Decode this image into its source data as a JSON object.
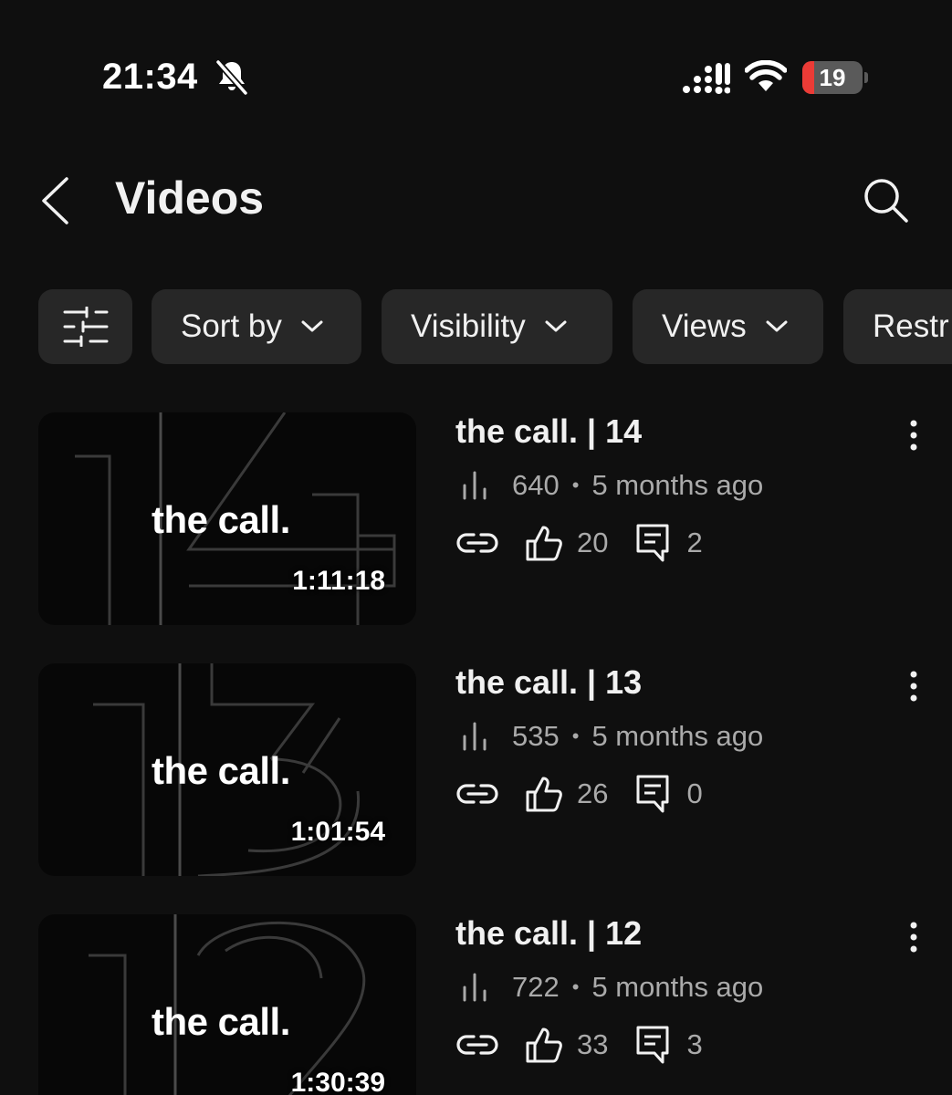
{
  "status_bar": {
    "time": "21:34",
    "battery_level": "19",
    "battery_fraction": 0.19,
    "icons": [
      "bell-off-icon",
      "signal-icon",
      "wifi-icon",
      "battery-icon"
    ]
  },
  "header": {
    "title": "Videos",
    "back_icon": "chevron-left-icon",
    "search_icon": "search-icon"
  },
  "filters": {
    "filter_icon": "sliders-icon",
    "chips": [
      {
        "label": "Sort by"
      },
      {
        "label": "Visibility"
      },
      {
        "label": "Views"
      },
      {
        "label": "Restr"
      }
    ]
  },
  "videos": [
    {
      "title": "the call. | 14",
      "thumbnail_text": "the call.",
      "duration": "1:11:18",
      "views": "640",
      "age": "5 months ago",
      "likes": "20",
      "comments": "2"
    },
    {
      "title": "the call. | 13",
      "thumbnail_text": "the call.",
      "duration": "1:01:54",
      "views": "535",
      "age": "5 months ago",
      "likes": "26",
      "comments": "0"
    },
    {
      "title": "the call. | 12",
      "thumbnail_text": "the call.",
      "duration": "1:30:39",
      "views": "722",
      "age": "5 months ago",
      "likes": "33",
      "comments": "3"
    }
  ],
  "meta_separator": "•",
  "colors": {
    "background": "#0f0f0f",
    "chip_background": "#272727",
    "primary_text": "#f1f1f1",
    "secondary_text": "#aaaaaa",
    "battery_low": "#eb3b36"
  }
}
